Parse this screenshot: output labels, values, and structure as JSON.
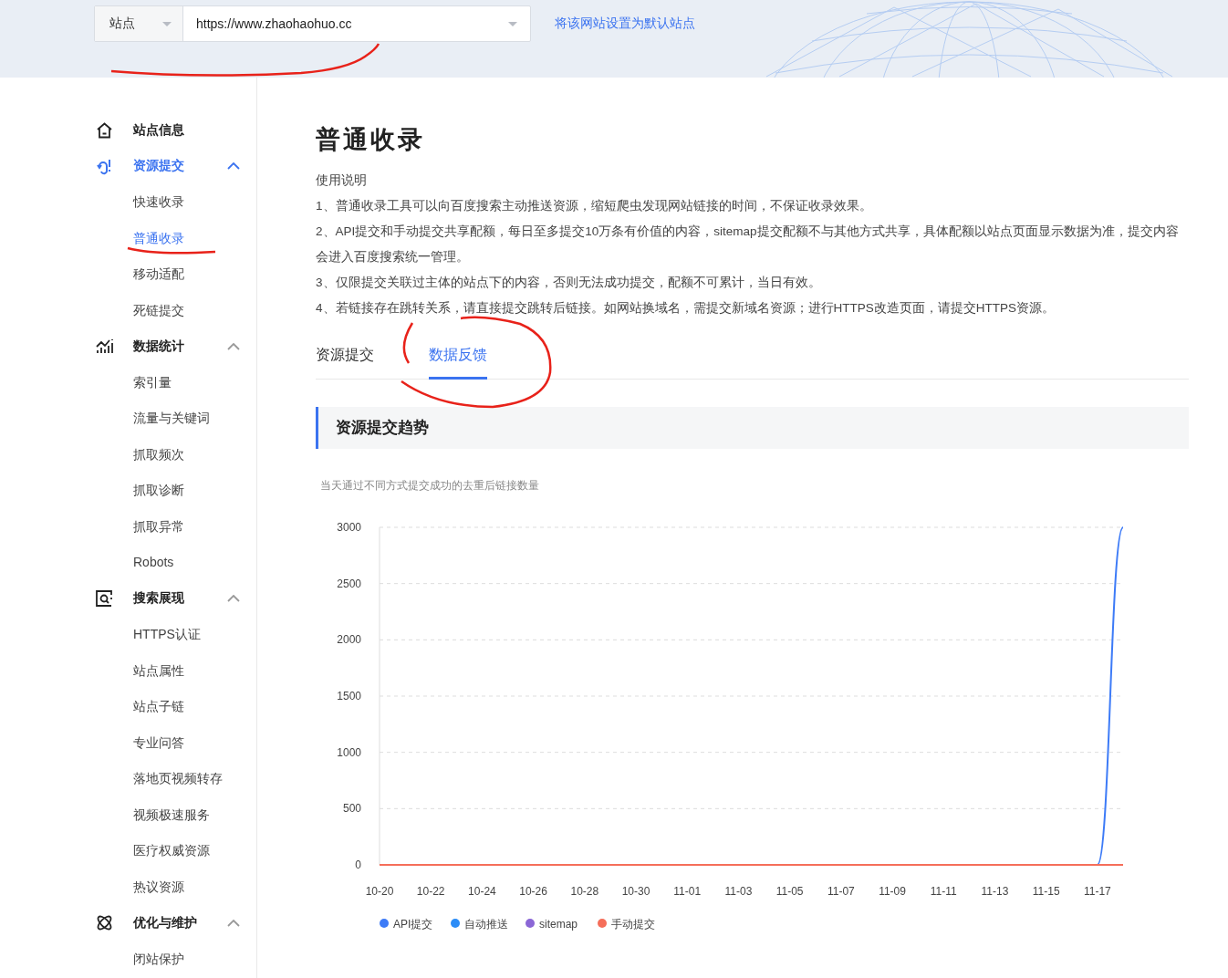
{
  "site_selector": {
    "label": "站点",
    "value": "https://www.zhaohaohuo.cc",
    "set_default_link": "将该网站设置为默认站点"
  },
  "sidebar": {
    "groups": [
      {
        "label": "站点信息",
        "selected": false
      },
      {
        "label": "资源提交",
        "selected": true,
        "expanded": true,
        "children": [
          {
            "label": "快速收录",
            "selected": false
          },
          {
            "label": "普通收录",
            "selected": true
          },
          {
            "label": "移动适配",
            "selected": false
          },
          {
            "label": "死链提交",
            "selected": false
          }
        ]
      },
      {
        "label": "数据统计",
        "selected": false,
        "expanded": true,
        "children": [
          {
            "label": "索引量",
            "selected": false
          },
          {
            "label": "流量与关键词",
            "selected": false
          },
          {
            "label": "抓取频次",
            "selected": false
          },
          {
            "label": "抓取诊断",
            "selected": false
          },
          {
            "label": "抓取异常",
            "selected": false
          },
          {
            "label": "Robots",
            "selected": false
          }
        ]
      },
      {
        "label": "搜索展现",
        "selected": false,
        "expanded": true,
        "children": [
          {
            "label": "HTTPS认证",
            "selected": false
          },
          {
            "label": "站点属性",
            "selected": false
          },
          {
            "label": "站点子链",
            "selected": false
          },
          {
            "label": "专业问答",
            "selected": false
          },
          {
            "label": "落地页视频转存",
            "selected": false
          },
          {
            "label": "视频极速服务",
            "selected": false
          },
          {
            "label": "医疗权威资源",
            "selected": false
          },
          {
            "label": "热议资源",
            "selected": false
          }
        ]
      },
      {
        "label": "优化与维护",
        "selected": false,
        "expanded": true,
        "children": [
          {
            "label": "闭站保护",
            "selected": false
          }
        ]
      }
    ]
  },
  "page": {
    "title": "普通收录",
    "instructions_heading": "使用说明",
    "instructions": [
      "1、普通收录工具可以向百度搜索主动推送资源，缩短爬虫发现网站链接的时间，不保证收录效果。",
      "2、API提交和手动提交共享配额，每日至多提交10万条有价值的内容，sitemap提交配额不与其他方式共享，具体配额以站点页面显示数据为准，提交内容会进入百度搜索统一管理。",
      "3、仅限提交关联过主体的站点下的内容，否则无法成功提交，配额不可累计，当日有效。",
      "4、若链接存在跳转关系，请直接提交跳转后链接。如网站换域名，需提交新域名资源；进行HTTPS改造页面，请提交HTTPS资源。"
    ],
    "tabs": [
      {
        "label": "资源提交",
        "selected": false
      },
      {
        "label": "数据反馈",
        "selected": true
      }
    ],
    "section_title": "资源提交趋势",
    "chart_subtitle": "当天通过不同方式提交成功的去重后链接数量",
    "chart_data": {
      "type": "line",
      "categories": [
        "10-20",
        null,
        "10-22",
        null,
        "10-24",
        null,
        "10-26",
        null,
        "10-28",
        null,
        "10-30",
        null,
        "11-01",
        null,
        "11-03",
        null,
        "11-05",
        null,
        "11-07",
        null,
        "11-09",
        null,
        "11-11",
        null,
        "11-13",
        null,
        "11-15",
        null,
        "11-17",
        null
      ],
      "ylim": [
        0,
        3000
      ],
      "yticks": [
        0,
        500,
        1000,
        1500,
        2000,
        2500,
        3000
      ],
      "grid": true,
      "legend": true,
      "series": [
        {
          "name": "API提交",
          "color": "#3d7bf7",
          "values": [
            null,
            null,
            null,
            null,
            null,
            null,
            null,
            null,
            null,
            null,
            null,
            null,
            null,
            null,
            null,
            null,
            null,
            null,
            null,
            null,
            null,
            null,
            null,
            null,
            null,
            null,
            null,
            null,
            0,
            3000
          ]
        },
        {
          "name": "自动推送",
          "color": "#2b8cf7",
          "values": [
            null,
            null,
            null,
            null,
            null,
            null,
            null,
            null,
            null,
            null,
            null,
            null,
            null,
            null,
            null,
            null,
            null,
            null,
            null,
            null,
            null,
            null,
            null,
            null,
            null,
            null,
            null,
            null,
            null,
            null
          ]
        },
        {
          "name": "sitemap",
          "color": "#8b67d6",
          "values": [
            null,
            null,
            null,
            null,
            null,
            null,
            null,
            null,
            null,
            null,
            null,
            null,
            null,
            null,
            null,
            null,
            null,
            null,
            null,
            null,
            null,
            null,
            null,
            null,
            null,
            null,
            null,
            null,
            null,
            null
          ]
        },
        {
          "name": "手动提交",
          "color": "#f56e5a",
          "values": [
            0,
            0,
            0,
            0,
            0,
            0,
            0,
            0,
            0,
            0,
            0,
            0,
            0,
            0,
            0,
            0,
            0,
            0,
            0,
            0,
            0,
            0,
            0,
            0,
            0,
            0,
            0,
            0,
            0,
            0
          ]
        }
      ]
    }
  }
}
